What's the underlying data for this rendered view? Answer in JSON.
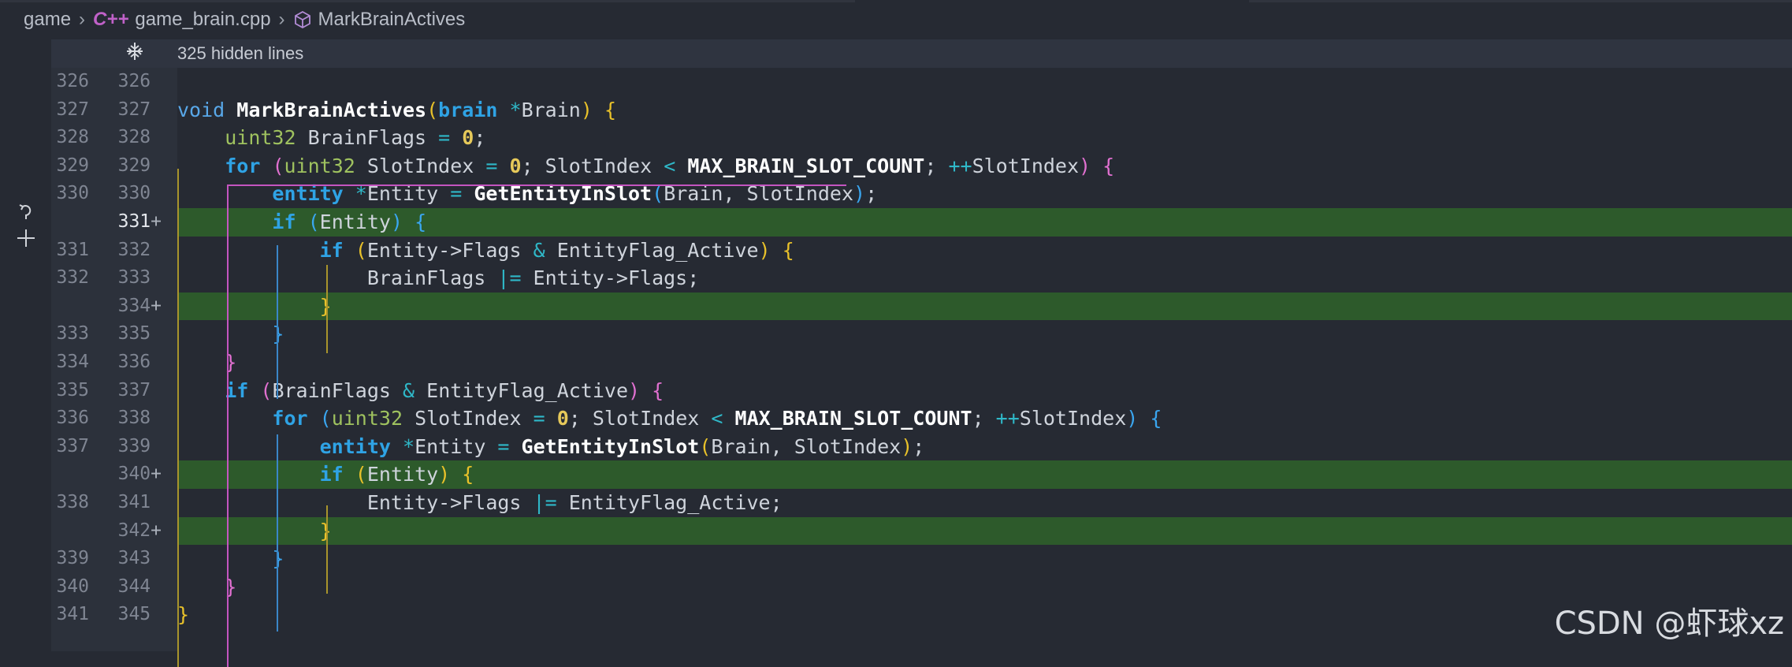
{
  "breadcrumb": {
    "folder": "game",
    "file": "game_brain.cpp",
    "file_icon": "C++",
    "symbol": "MarkBrainActives"
  },
  "hidden_lines": {
    "label": "325 hidden lines"
  },
  "colors": {
    "added_background": "#2d5a2b",
    "keyword": "#2fa3e5",
    "type": "#9fc25f",
    "number": "#e6c95a",
    "bracket_level_1": "#e8c12a",
    "bracket_level_2": "#e070d0",
    "bracket_level_3": "#3aa6f0"
  },
  "lines": [
    {
      "old": "326",
      "new": "326",
      "added": false,
      "code": ""
    },
    {
      "old": "327",
      "new": "327",
      "added": false,
      "code": "void MarkBrainActives(brain *Brain) {"
    },
    {
      "old": "328",
      "new": "328",
      "added": false,
      "code": "    uint32 BrainFlags = 0;"
    },
    {
      "old": "329",
      "new": "329",
      "added": false,
      "code": "    for (uint32 SlotIndex = 0; SlotIndex < MAX_BRAIN_SLOT_COUNT; ++SlotIndex) {"
    },
    {
      "old": "330",
      "new": "330",
      "added": false,
      "code": "        entity *Entity = GetEntityInSlot(Brain, SlotIndex);"
    },
    {
      "old": "",
      "new": "331",
      "added": true,
      "code": "        if (Entity) {"
    },
    {
      "old": "331",
      "new": "332",
      "added": false,
      "code": "            if (Entity->Flags & EntityFlag_Active) {"
    },
    {
      "old": "332",
      "new": "333",
      "added": false,
      "code": "                BrainFlags |= Entity->Flags;"
    },
    {
      "old": "",
      "new": "334",
      "added": true,
      "code": "            }"
    },
    {
      "old": "333",
      "new": "335",
      "added": false,
      "code": "        }"
    },
    {
      "old": "334",
      "new": "336",
      "added": false,
      "code": "    }"
    },
    {
      "old": "335",
      "new": "337",
      "added": false,
      "code": "    if (BrainFlags & EntityFlag_Active) {"
    },
    {
      "old": "336",
      "new": "338",
      "added": false,
      "code": "        for (uint32 SlotIndex = 0; SlotIndex < MAX_BRAIN_SLOT_COUNT; ++SlotIndex) {"
    },
    {
      "old": "337",
      "new": "339",
      "added": false,
      "code": "            entity *Entity = GetEntityInSlot(Brain, SlotIndex);"
    },
    {
      "old": "",
      "new": "340",
      "added": true,
      "code": "            if (Entity) {"
    },
    {
      "old": "338",
      "new": "341",
      "added": false,
      "code": "                Entity->Flags |= EntityFlag_Active;"
    },
    {
      "old": "",
      "new": "342",
      "added": true,
      "code": "            }"
    },
    {
      "old": "339",
      "new": "343",
      "added": false,
      "code": "        }"
    },
    {
      "old": "340",
      "new": "344",
      "added": false,
      "code": "    }"
    },
    {
      "old": "341",
      "new": "345",
      "added": false,
      "code": "}"
    }
  ],
  "added_marker": "+",
  "watermark": "CSDN @虾球xz"
}
